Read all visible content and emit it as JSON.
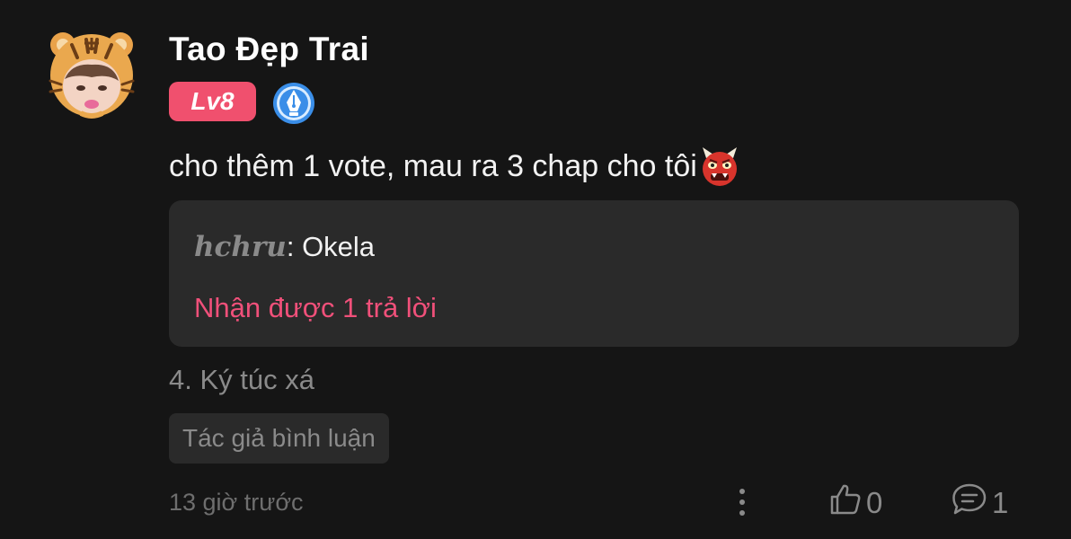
{
  "comment": {
    "username": "Tao Đẹp Trai",
    "level_badge": "Lv8",
    "text": "cho thêm 1 vote, mau ra 3 chap cho tôi",
    "emoji_icon": "ogre-devil-icon",
    "reply_preview": {
      "author": "𝒉𝒄𝒉𝒓𝒖",
      "separator": ": ",
      "text": "Okela",
      "reply_count_text": "Nhận được 1 trả lời"
    },
    "chapter": "4. Ký túc xá",
    "tag": "Tác giả bình luận",
    "time": "13 giờ trước",
    "like_count": "0",
    "reply_count": "1"
  },
  "colors": {
    "background": "#151515",
    "level_badge": "#f0506e",
    "reply_highlight": "#f0507a",
    "secondary_text": "#8a8a8a",
    "verified_badge": "#3a8ee8"
  }
}
